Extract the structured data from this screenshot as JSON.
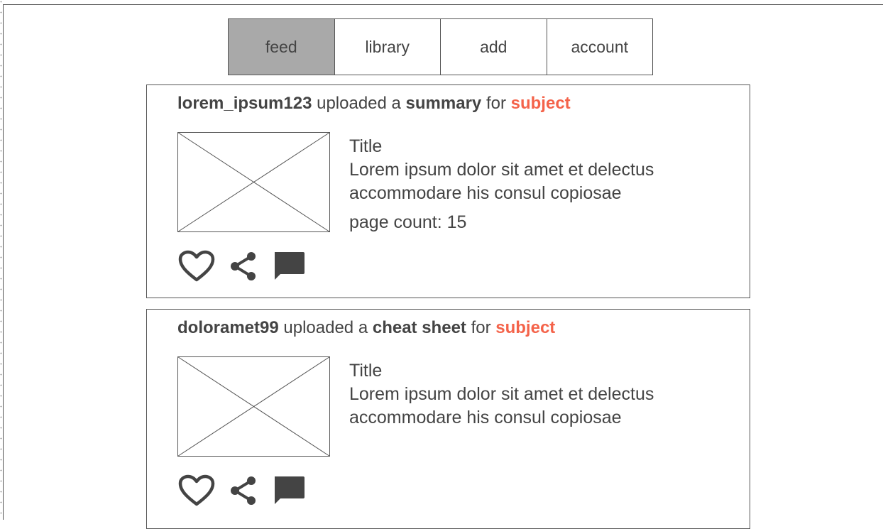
{
  "nav": {
    "tabs": [
      {
        "label": "feed",
        "active": true
      },
      {
        "label": "library",
        "active": false
      },
      {
        "label": "add",
        "active": false
      },
      {
        "label": "account",
        "active": false
      }
    ]
  },
  "feed": {
    "items": [
      {
        "user": "lorem_ipsum123",
        "action_text": "uploaded a",
        "content_type": "summary",
        "for_text": "for",
        "subject": "subject",
        "title": "Title",
        "description": "Lorem ipsum dolor sit amet et delectus accommodare his consul copiosae",
        "page_count": "page count: 15"
      },
      {
        "user": "doloramet99",
        "action_text": "uploaded a",
        "content_type": "cheat sheet",
        "for_text": "for",
        "subject": "subject",
        "title": "Title",
        "description": "Lorem ipsum dolor sit amet et delectus accommodare his consul copiosae"
      }
    ]
  },
  "icons": {
    "like": "heart-icon",
    "share": "share-icon",
    "comment": "comment-icon"
  },
  "colors": {
    "subject_accent": "#f4634a",
    "active_tab": "#a9a9a9",
    "text": "#444444"
  }
}
